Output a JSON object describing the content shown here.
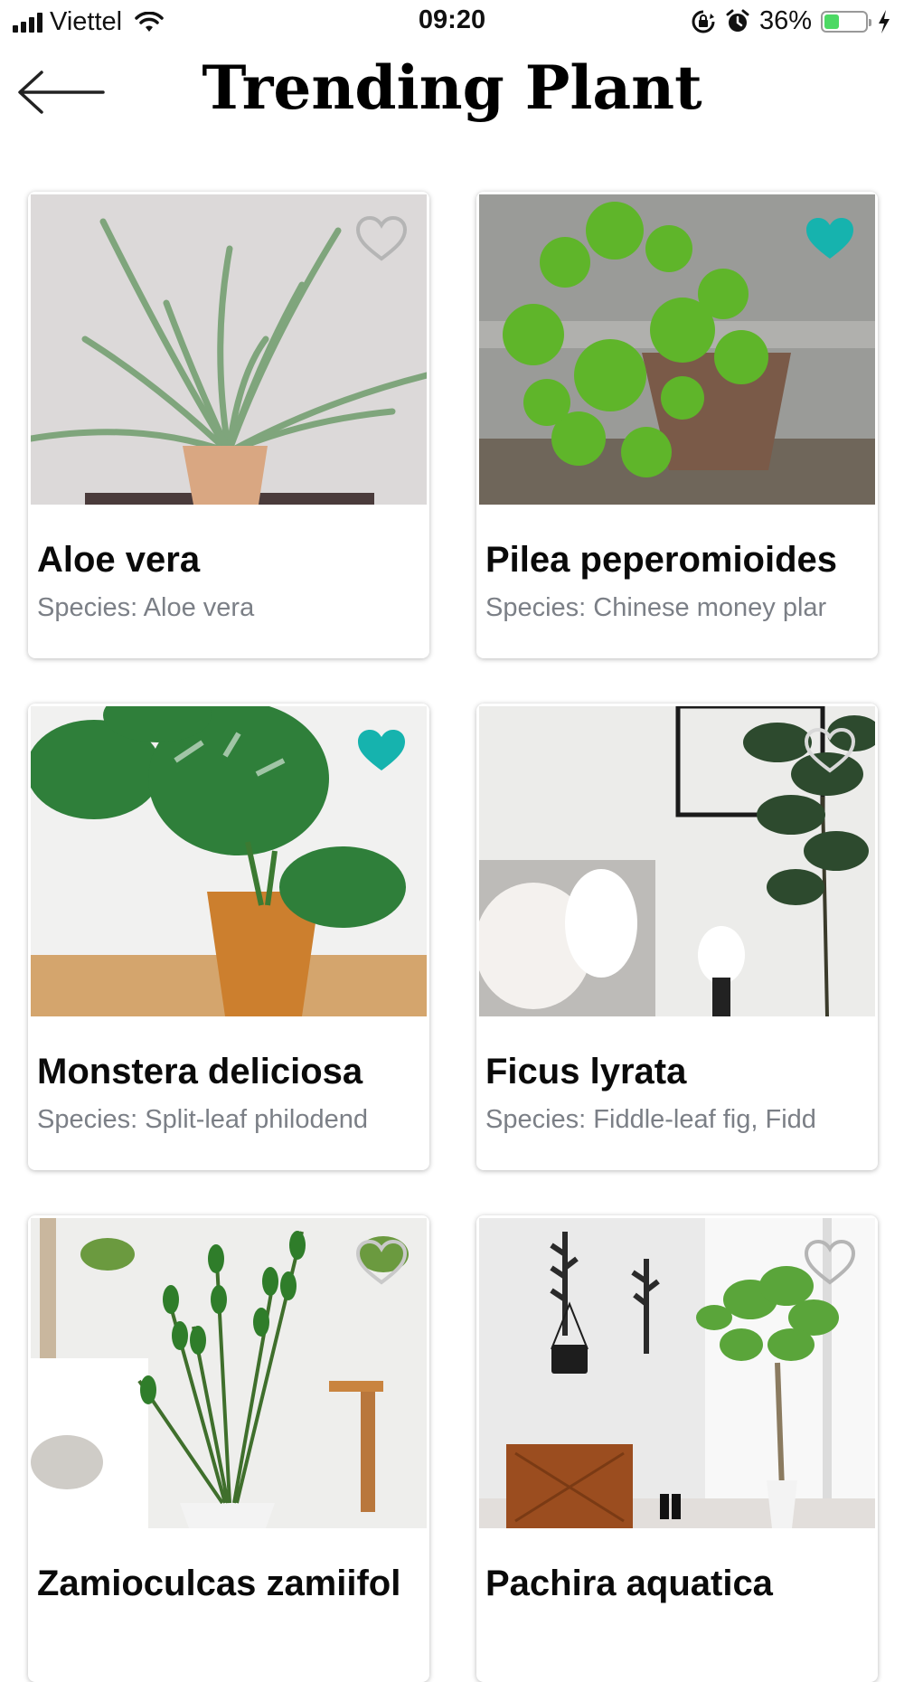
{
  "status_bar": {
    "carrier": "Viettel",
    "time": "09:20",
    "battery_percent": "36%",
    "battery_level": 0.36,
    "icons": [
      "signal-icon",
      "wifi-icon",
      "rotation-lock-icon",
      "alarm-icon",
      "battery-icon",
      "charging-icon"
    ]
  },
  "header": {
    "title": "Trending Plant",
    "back_icon": "arrow-left-icon"
  },
  "colors": {
    "accent": "#16b3ae",
    "heart_outline": "#b5b5b5",
    "species_text": "#7b7f86"
  },
  "plants": [
    {
      "name": "Aloe vera",
      "species": "Species: Aloe vera",
      "favorite": false,
      "image": "aloe-vera-photo"
    },
    {
      "name": "Pilea peperomioides",
      "species": "Species: Chinese money plar",
      "favorite": true,
      "image": "pilea-photo"
    },
    {
      "name": "Monstera deliciosa",
      "species": "Species: Split-leaf philodend",
      "favorite": true,
      "image": "monstera-photo"
    },
    {
      "name": "Ficus lyrata",
      "species": "Species: Fiddle-leaf fig, Fidd",
      "favorite": false,
      "image": "ficus-photo"
    },
    {
      "name": "Zamioculcas zamiifol",
      "species": "",
      "favorite": false,
      "image": "zz-plant-photo"
    },
    {
      "name": "Pachira aquatica",
      "species": "",
      "favorite": false,
      "image": "pachira-photo"
    }
  ]
}
